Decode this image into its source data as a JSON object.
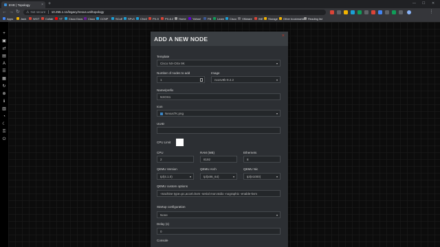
{
  "browser": {
    "tab_title": "EVE | Topology",
    "url_security": "Not secure",
    "url": "10.255.1.11/legacy/nexus.unl/topology",
    "bookmarks": [
      {
        "label": "Apps",
        "color": "#4285f4"
      },
      {
        "label": "Jack",
        "color": "#f4b400"
      },
      {
        "label": "WGT",
        "color": "#db4437"
      },
      {
        "label": "Collab",
        "color": "#db4437"
      },
      {
        "label": "YT",
        "color": "#ff0000"
      },
      {
        "label": "Cisco Docs",
        "color": "#1ba0d7"
      },
      {
        "label": "Cisco",
        "color": "#6a1b9a"
      },
      {
        "label": "CCNP",
        "color": "#1ba0d7"
      },
      {
        "label": "SCoE",
        "color": "#1ba0d7"
      },
      {
        "label": "SPv3",
        "color": "#1ba0d7"
      },
      {
        "label": "CNv2",
        "color": "#1ba0d7"
      },
      {
        "label": "PX-9",
        "color": "#db4437"
      },
      {
        "label": "PX-6.2",
        "color": "#db4437"
      },
      {
        "label": "Home",
        "color": "#9e9e9e"
      },
      {
        "label": "Yahoo!",
        "color": "#6001d2"
      },
      {
        "label": "FB",
        "color": "#3b5998"
      },
      {
        "label": "Learn",
        "color": "#0f9d58"
      },
      {
        "label": "Cisco",
        "color": "#1ba0d7"
      },
      {
        "label": "VMware",
        "color": "#717074"
      },
      {
        "label": "INE",
        "color": "#db4437"
      },
      {
        "label": "Storage",
        "color": "#f4b400"
      },
      {
        "label": "Other bookmarks",
        "color": "#f4b400"
      },
      {
        "label": "Reading list",
        "color": "#9e9e9e"
      }
    ]
  },
  "sidebar": {
    "icons": [
      "add-icon",
      "device-icon",
      "network-icon",
      "picture-icon",
      "text-icon",
      "list-icon",
      "grid-icon",
      "refresh-icon",
      "zoom-icon",
      "info-icon",
      "table-icon",
      "status-icon",
      "moon-icon",
      "lock-icon",
      "exit-icon"
    ]
  },
  "modal": {
    "title": "ADD A NEW NODE",
    "close": "×",
    "template_label": "Template",
    "template_value": "Cisco NX-OSv 9K",
    "count_label": "Number of nodes to add",
    "count_value": "1",
    "image_label": "Image",
    "image_value": "nxosv9k-9.2.2",
    "name_label": "Name/prefix",
    "name_value": "NXOS1",
    "icon_label": "Icon",
    "icon_value": "Nexus7K.png",
    "uuid_label": "UUID",
    "uuid_value": "",
    "cpu_limit_label": "CPU Limit",
    "cpu_label": "CPU",
    "cpu_value": "2",
    "ram_label": "RAM (MB)",
    "ram_value": "8192",
    "eth_label": "Ethernets",
    "eth_value": "8",
    "qemu_version_label": "QEMU Version",
    "qemu_version_value": "tpl(4.1.0)",
    "qemu_arch_label": "QEMU Arch",
    "qemu_arch_value": "tpl(x86_64)",
    "qemu_nic_label": "QEMU Nic",
    "qemu_nic_value": "tpl(e1000)",
    "qemu_opts_label": "QEMU custom options",
    "qemu_opts_value": "-machine type=pc,accel=kvm -serial mon:stdio -nographic -enable-kvm",
    "startup_label": "Startup configuration",
    "startup_value": "None",
    "delay_label": "Delay (s)",
    "delay_value": "0",
    "console_label": "Console"
  },
  "colors": {
    "modal_bg": "#2c2f33",
    "modal_header": "#3a3e42",
    "field_bg": "#24272a",
    "close_red": "#c0392b"
  }
}
